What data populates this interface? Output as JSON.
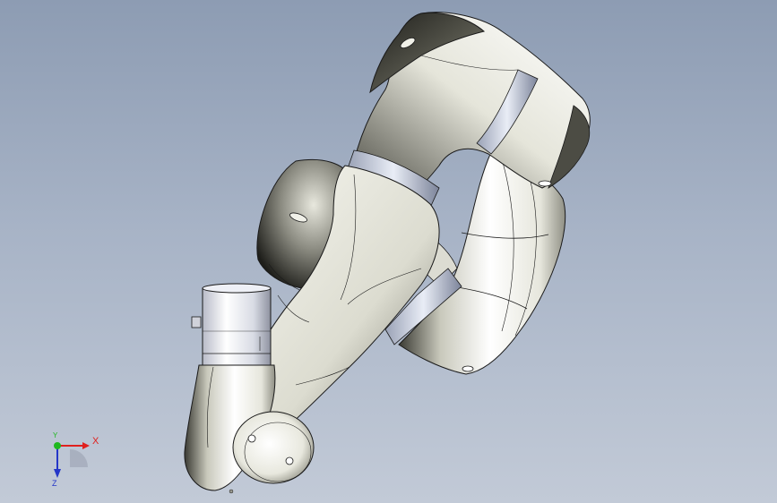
{
  "triad": {
    "x_label": "X",
    "y_label": "Y",
    "z_label": "Z",
    "x_color": "#e0201e",
    "y_color": "#1fb81f",
    "z_color": "#2436c8"
  },
  "model": {
    "shell_color": "#f4f4ee",
    "shadow_color": "#2a2a26",
    "edge_color": "#1a1a1a"
  },
  "icons": {
    "triad": "axis-triad-icon"
  }
}
